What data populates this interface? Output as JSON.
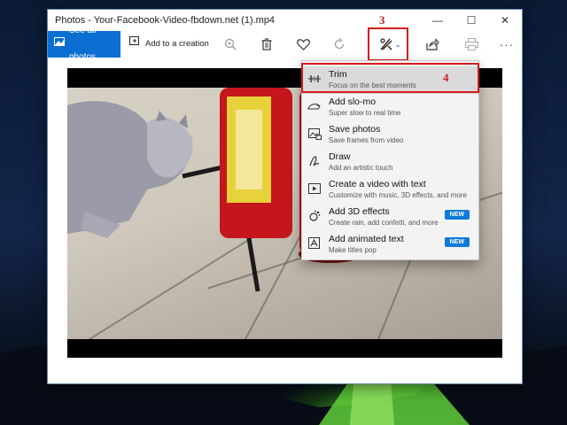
{
  "window": {
    "title": "Photos - Your-Facebook-Video-fbdown.net (1).mp4",
    "minimize": "—",
    "maximize": "☐",
    "close": "✕"
  },
  "toolbar": {
    "see_all_photos": "See all photos",
    "add_to_creation": "Add to a creation",
    "icons": [
      "photos-icon",
      "add-creation-icon",
      "zoom-icon",
      "delete-icon",
      "favorite-icon",
      "rotate-icon",
      "edit-create-icon",
      "chevron-down-icon",
      "share-icon",
      "print-icon",
      "more-icon"
    ],
    "accent": "#0b6fd1"
  },
  "annotations": {
    "step3": "3",
    "step4": "4",
    "color": "#d61b1b"
  },
  "menu": {
    "items": [
      {
        "title": "Trim",
        "subtitle": "Focus on the best moments",
        "icon": "trim-icon",
        "badge": ""
      },
      {
        "title": "Add slo-mo",
        "subtitle": "Super slow to real time",
        "icon": "slomo-icon",
        "badge": ""
      },
      {
        "title": "Save photos",
        "subtitle": "Save frames from video",
        "icon": "save-photos-icon",
        "badge": ""
      },
      {
        "title": "Draw",
        "subtitle": "Add an artistic touch",
        "icon": "draw-icon",
        "badge": ""
      },
      {
        "title": "Create a video with text",
        "subtitle": "Customize with music, 3D effects, and more",
        "icon": "video-text-icon",
        "badge": ""
      },
      {
        "title": "Add 3D effects",
        "subtitle": "Create rain, add confetti, and more",
        "icon": "3d-effects-icon",
        "badge": "NEW"
      },
      {
        "title": "Add animated text",
        "subtitle": "Make titles pop",
        "icon": "animated-text-icon",
        "badge": "NEW"
      }
    ],
    "badge_color": "#0f7ad8"
  }
}
